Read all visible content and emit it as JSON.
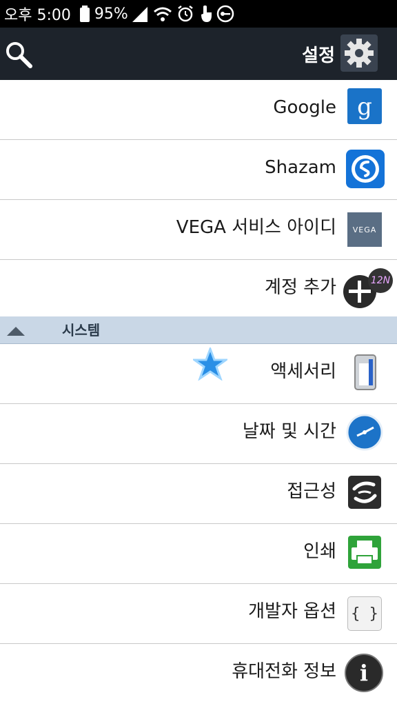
{
  "status_bar": {
    "time": "오후 5:00",
    "battery_percent": "95%",
    "icons": [
      "battery-icon",
      "signal-icon",
      "wifi-icon",
      "alarm-icon",
      "touch-icon",
      "key-icon"
    ]
  },
  "action_bar": {
    "title": "설정",
    "search_icon": "search-icon",
    "settings_icon": "gear-icon"
  },
  "accounts": [
    {
      "label": "Google",
      "icon": "google-icon"
    },
    {
      "label": "Shazam",
      "icon": "shazam-icon"
    },
    {
      "label": "VEGA 서비스 아이디",
      "icon": "vega-icon",
      "icon_text": "VEGA"
    },
    {
      "label": "계정 추가",
      "icon": "add-account-icon",
      "badge_text": "12N"
    }
  ],
  "system_section": {
    "title": "시스템",
    "items": [
      {
        "label": "액세서리",
        "icon": "accessory-icon"
      },
      {
        "label": "날짜 및 시간",
        "icon": "clock-icon"
      },
      {
        "label": "접근성",
        "icon": "accessibility-icon"
      },
      {
        "label": "인쇄",
        "icon": "printer-icon"
      },
      {
        "label": "개발자 옵션",
        "icon": "developer-braces-icon",
        "icon_text": "{ }"
      },
      {
        "label": "휴대전화 정보",
        "icon": "info-icon",
        "icon_text": "i"
      }
    ]
  },
  "colors": {
    "action_bar": "#1d232b",
    "section_header": "#c9d7e6",
    "divider": "#c8c8c8"
  }
}
